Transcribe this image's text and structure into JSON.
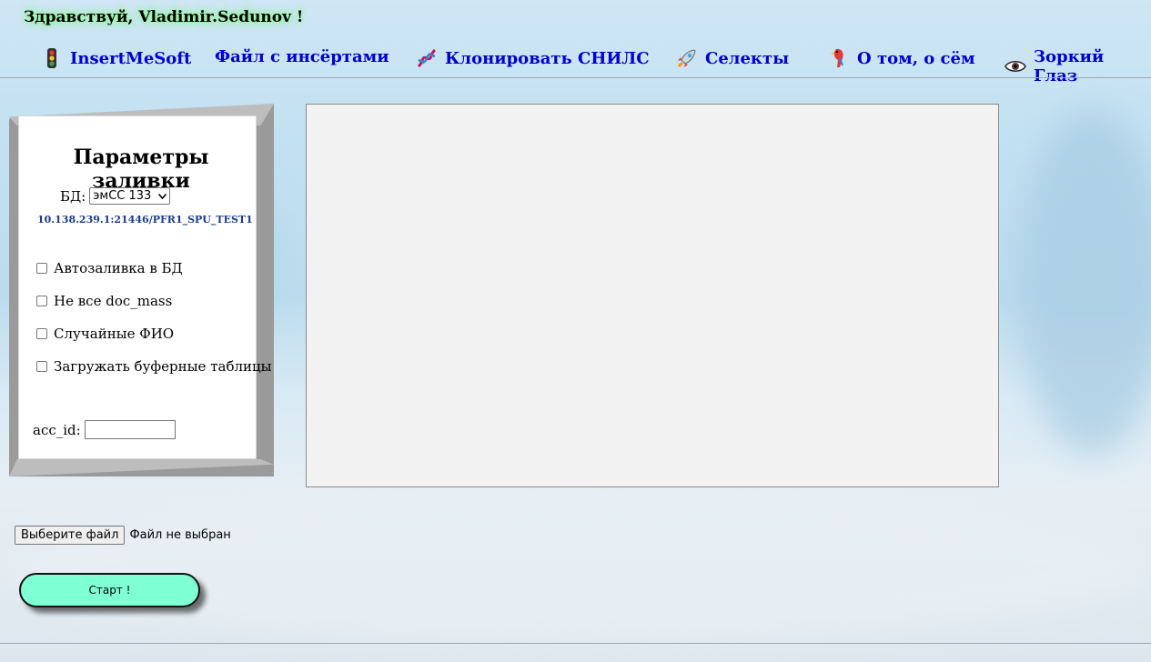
{
  "greeting": "Здравствуй, Vladimir.Sedunov !",
  "nav": {
    "items": [
      {
        "label": "InsertMeSoft",
        "icon": "traffic-light-icon"
      },
      {
        "label": "Файл с инсёртами",
        "icon": ""
      },
      {
        "label": "Клонировать СНИЛС",
        "icon": "dna-icon"
      },
      {
        "label": "Селекты",
        "icon": "rocket-icon"
      },
      {
        "label": "О том, о сём",
        "icon": "parrot-icon"
      },
      {
        "label": "Зоркий Глаз",
        "icon": "eye-icon"
      }
    ]
  },
  "params": {
    "title": "Параметры заливки",
    "db_label": "БД:",
    "db_selected": "эмСС 133",
    "db_connection": "10.138.239.1:21446/PFR1_SPU_TEST1",
    "checkboxes": [
      {
        "label": "Автозаливка в БД",
        "checked": false
      },
      {
        "label": "Не все doc_mass",
        "checked": false
      },
      {
        "label": "Случайные ФИО",
        "checked": false
      },
      {
        "label": "Загружать буферные таблицы",
        "checked": false
      }
    ],
    "acc_id_label": "acc_id:",
    "acc_id_value": ""
  },
  "file_input": {
    "button_label": "Выберите файл",
    "status": "Файл не выбран"
  },
  "start_button": "Старт !",
  "colors": {
    "nav_link": "#0000cc",
    "start_button_bg": "#7fffd4",
    "output_bg": "#f2f2f2"
  }
}
